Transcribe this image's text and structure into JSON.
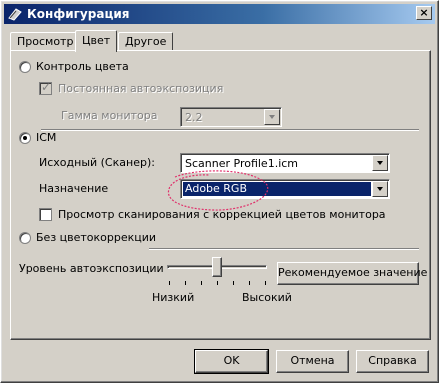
{
  "window": {
    "title": "Конфигурация",
    "icon": "scanner-app-icon",
    "close_label": "×"
  },
  "tabs": [
    {
      "label": "Просмотр",
      "active": false
    },
    {
      "label": "Цвет",
      "active": true
    },
    {
      "label": "Другое",
      "active": false
    }
  ],
  "color_control": {
    "radio_label": "Контроль цвета",
    "selected": false,
    "auto_exposure_label": "Постоянная автоэкспозиция",
    "auto_exposure_checked": true,
    "gamma_label": "Гамма монитора",
    "gamma_value": "2.2"
  },
  "icm": {
    "radio_label": "ICM",
    "selected": true,
    "source_label": "Исходный (Сканер):",
    "source_value": "Scanner Profile1.icm",
    "target_label": "Назначение",
    "target_value": "Adobe RGB",
    "preview_label": "Просмотр сканирования с коррекцией цветов монитора",
    "preview_checked": false
  },
  "no_correction": {
    "radio_label": "Без цветокоррекции",
    "selected": false
  },
  "exposure": {
    "label": "Уровень автоэкспозиции",
    "low_label": "Низкий",
    "high_label": "Высокий",
    "level": 0.5,
    "ticks": 7,
    "recommended_button": "Рекомендуемое значение"
  },
  "buttons": {
    "ok": "OK",
    "cancel": "Отмена",
    "help": "Справка"
  },
  "colors": {
    "annotation": "#e0306a",
    "selection": "#0a246a"
  }
}
